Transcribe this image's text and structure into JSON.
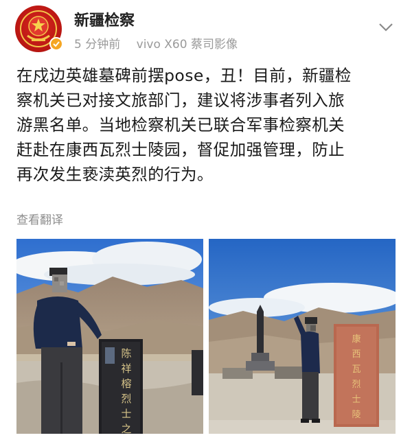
{
  "post": {
    "account_name": "新疆检察",
    "time_ago": "5 分钟前",
    "device": "vivo X60 蔡司影像",
    "text_lines": [
      "在戍边英雄墓碑前摆pose，丑！目前，新疆检",
      "察机关已对接文旅部门，建议将涉事者列入旅",
      "游黑名单。当地检察机关已联合军事检察机关",
      "赶赴在康西瓦烈士陵园，督促加强管理，防止",
      "再次发生亵渎英烈的行为。"
    ],
    "translate_label": "查看翻译"
  },
  "photos": {
    "left": {
      "tombstone_text": "陈祥榕烈士之墓"
    },
    "right": {
      "stone_text": "康西瓦烈士陵园"
    }
  },
  "icons": {
    "avatar": "procuratorate-emblem-icon",
    "verified": "verified-badge-icon",
    "menu": "chevron-down-icon"
  },
  "colors": {
    "avatar_red": "#c81e18",
    "verified_orange": "#f5a623",
    "meta_gray": "#9a9a9a"
  }
}
